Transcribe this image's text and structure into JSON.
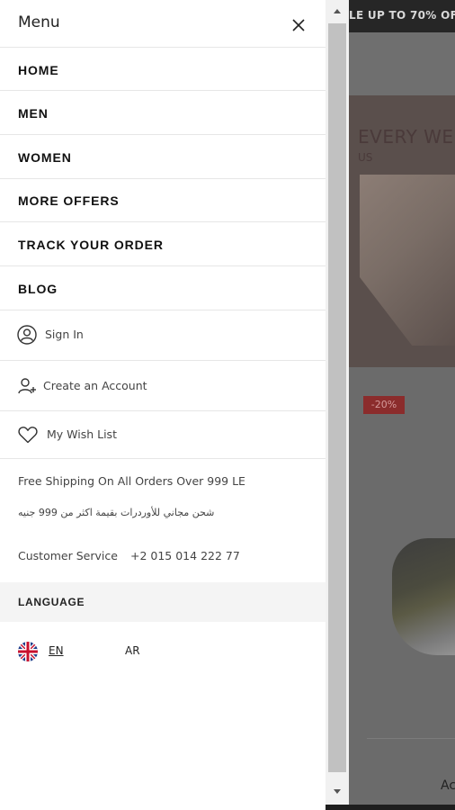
{
  "background_page": {
    "promo_text": "LE UP TO 70% OFF",
    "hero_title": "EVERY WE",
    "hero_sub": "US",
    "discount_badge": "-20%",
    "add_text": "Ac"
  },
  "drawer": {
    "title": "Menu",
    "close_icon": "close-icon",
    "nav_items": [
      {
        "label": "HOME"
      },
      {
        "label": "MEN"
      },
      {
        "label": "WOMEN"
      },
      {
        "label": "MORE OFFERS"
      },
      {
        "label": "TRACK YOUR ORDER"
      },
      {
        "label": "BLOG"
      }
    ],
    "account": {
      "sign_in": "Sign In",
      "create_account": "Create an Account",
      "wish_list": "My Wish List"
    },
    "info": {
      "free_shipping": "Free Shipping On All Orders Over 999 LE",
      "free_shipping_ar": "شحن مجاني للأوردرات بقيمة اكثر من 999 جنيه",
      "customer_service_label": "Customer Service",
      "customer_service_number": "+2 015 014 222 77"
    },
    "language": {
      "heading": "LANGUAGE",
      "en": "EN",
      "ar": "AR"
    }
  },
  "colors": {
    "overlay": "#6b6b6b",
    "drawer_bg": "#ffffff",
    "divider": "#e6e6e6",
    "language_band": "#f4f4f4",
    "scroll_thumb": "#c1c1c1"
  }
}
